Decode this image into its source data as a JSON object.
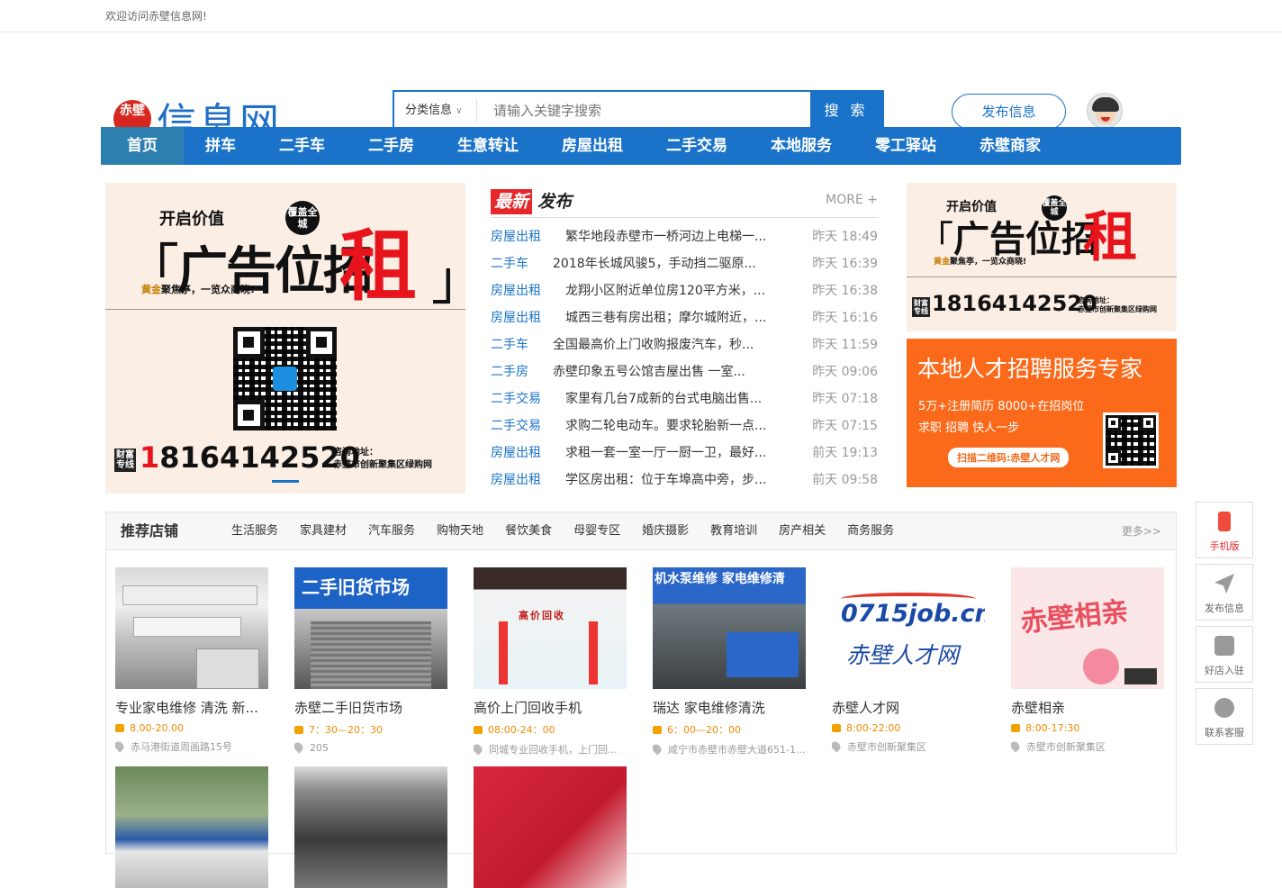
{
  "topbar": {
    "welcome": "欢迎访问赤壁信息网!"
  },
  "logo": {
    "seal": "赤壁",
    "name": "信息网"
  },
  "search": {
    "category": "分类信息",
    "placeholder": "请输入关键字搜索",
    "button": "搜 索"
  },
  "header": {
    "publish": "发布信息"
  },
  "nav": {
    "items": [
      "首页",
      "拼车",
      "二手车",
      "二手房",
      "生意转让",
      "房屋出租",
      "二手交易",
      "本地服务",
      "零工驿站",
      "赤壁商家"
    ]
  },
  "ad_left": {
    "open": "开启价值",
    "headline": "广告位招",
    "big": "租",
    "badge": "覆盖全城",
    "slogan_gold": "黄金",
    "slogan": "聚焦亭，一览众商晓!",
    "hotline_tag": "财富专线",
    "phone_prefix": "1",
    "phone": "8164142520",
    "addr_label": "咨询地址：",
    "addr": "赤壁市创新聚集区绿购网"
  },
  "news": {
    "title_red": "最新",
    "title_dark": "发布",
    "more": "MORE +",
    "items": [
      {
        "cat": "房屋出租",
        "title": "繁华地段赤壁市一桥河边上电梯一...",
        "time": "昨天 18:49"
      },
      {
        "cat": "二手车",
        "title": "2018年长城风骏5，手动挡二驱原...",
        "time": "昨天 16:39"
      },
      {
        "cat": "房屋出租",
        "title": "龙翔小区附近单位房120平方米，...",
        "time": "昨天 16:38"
      },
      {
        "cat": "房屋出租",
        "title": "城西三巷有房出租；摩尔城附近，...",
        "time": "昨天 16:16"
      },
      {
        "cat": "二手车",
        "title": "全国最高价上门收购报废汽车，秒...",
        "time": "昨天 11:59"
      },
      {
        "cat": "二手房",
        "title": "赤壁印象五号公馆吉屋出售 一室...",
        "time": "昨天 09:06"
      },
      {
        "cat": "二手交易",
        "title": "家里有几台7成新的台式电脑出售...",
        "time": "昨天 07:18"
      },
      {
        "cat": "二手交易",
        "title": "求购二轮电动车。要求轮胎新一点...",
        "time": "昨天 07:15"
      },
      {
        "cat": "房屋出租",
        "title": "求租一套一室一厅一厨一卫，最好...",
        "time": "前天 19:13"
      },
      {
        "cat": "房屋出租",
        "title": "学区房出租：位于车埠高中旁，步...",
        "time": "前天 09:58"
      }
    ]
  },
  "ad_right_top": {
    "open": "开启价值",
    "headline": "广告位招",
    "big": "租",
    "badge": "覆盖全城",
    "slogan_gold": "黄金",
    "slogan": "聚焦亭，一览众商晓!",
    "hotline_tag": "财富专线",
    "phone": "18164142520",
    "addr_label": "咨询地址：",
    "addr": "赤壁市创新聚集区绿购网"
  },
  "ad_right_bot": {
    "title": "本地人才招聘服务专家",
    "line1": "5万+注册简历 8000+在招岗位",
    "line2": "求职 招聘 快人一步",
    "cta": "扫描二维码:赤壁人才网"
  },
  "shops": {
    "title": "推荐店铺",
    "tabs": [
      "生活服务",
      "家具建材",
      "汽车服务",
      "购物天地",
      "餐饮美食",
      "母婴专区",
      "婚庆摄影",
      "教育培训",
      "房产相关",
      "商务服务"
    ],
    "more": "更多>>",
    "cards": [
      {
        "name": "专业家电维修 清洗 新...",
        "hours": "8.00-20.00",
        "addr": "赤马港街道周画路15号",
        "img_text": ""
      },
      {
        "name": "赤壁二手旧货市场",
        "hours": "7：30—20：30",
        "addr": "205",
        "img_text": "二手旧货市场"
      },
      {
        "name": "高价上门回收手机",
        "hours": "08:00-24：00",
        "addr": "同城专业回收手机，上门回...",
        "img_text": "高价回收"
      },
      {
        "name": "瑞达 家电维修清洗",
        "hours": "6：00—20：00",
        "addr": "咸宁市赤壁市赤壁大道651-1...",
        "img_text": "机水泵维修 家电维修清"
      },
      {
        "name": "赤壁人才网",
        "hours": "8:00-22:00",
        "addr": "赤壁市创新聚集区",
        "img_text": "0715job.cn",
        "img_sub": "赤壁人才网"
      },
      {
        "name": "赤壁相亲",
        "hours": "8:00-17:30",
        "addr": "赤壁市创新聚集区",
        "img_text": "赤壁相亲"
      }
    ]
  },
  "sidebar": {
    "items": [
      "手机版",
      "发布信息",
      "好店入驻",
      "联系客服"
    ]
  }
}
